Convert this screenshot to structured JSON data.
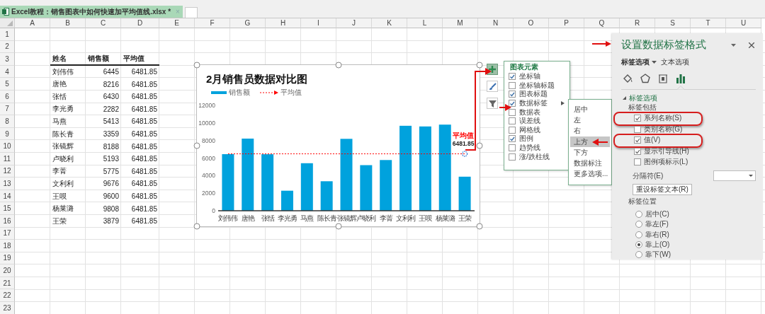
{
  "tab": {
    "title": "Excel教程：销售图表中如何快速加平均值线.xlsx *",
    "close": "×"
  },
  "sheet": {
    "columns": [
      "A",
      "B",
      "C",
      "D",
      "E",
      "F",
      "G",
      "H",
      "I",
      "J",
      "K",
      "L",
      "M",
      "N",
      "O",
      "P",
      "Q",
      "R",
      "S",
      "T",
      "U"
    ],
    "rows": [
      "1",
      "2",
      "3",
      "4",
      "5",
      "6",
      "7",
      "8",
      "9",
      "10",
      "11",
      "12",
      "13",
      "14",
      "15",
      "16",
      "17",
      "18",
      "19",
      "20",
      "21",
      "22",
      "23"
    ],
    "table": {
      "header": [
        "姓名",
        "销售额",
        "平均值"
      ],
      "rows": [
        [
          "刘伟伟",
          "6445",
          "6481.85"
        ],
        [
          "唐艳",
          "8216",
          "6481.85"
        ],
        [
          "张恬",
          "6430",
          "6481.85"
        ],
        [
          "李光勇",
          "2282",
          "6481.85"
        ],
        [
          "马燕",
          "5413",
          "6481.85"
        ],
        [
          "陈长青",
          "3359",
          "6481.85"
        ],
        [
          "张镜辉",
          "8188",
          "6481.85"
        ],
        [
          "卢晓利",
          "5193",
          "6481.85"
        ],
        [
          "李菁",
          "5775",
          "6481.85"
        ],
        [
          "文利利",
          "9676",
          "6481.85"
        ],
        [
          "王呗",
          "9600",
          "6481.85"
        ],
        [
          "杨莱潞",
          "9808",
          "6481.85"
        ],
        [
          "王荣",
          "3879",
          "6481.85"
        ]
      ]
    }
  },
  "chart": {
    "title": "2月销售员数据对比图",
    "point_label": [
      "平均值",
      "6481.85"
    ],
    "chart_data": {
      "type": "bar",
      "categories": [
        "刘伟伟",
        "唐艳",
        "张恬",
        "李光勇",
        "马燕",
        "陈长青",
        "张镜辉",
        "卢晓利",
        "李菁",
        "文利利",
        "王呗",
        "杨莱潞",
        "王荣"
      ],
      "series": [
        {
          "name": "销售额",
          "type": "bar",
          "color": "#00a2dd",
          "values": [
            6445,
            8216,
            6430,
            2282,
            5413,
            3359,
            8188,
            5193,
            5775,
            9676,
            9600,
            9808,
            3879
          ]
        },
        {
          "name": "平均值",
          "type": "line",
          "line_style": "dashed",
          "color": "#ff0000",
          "values": [
            6481.85,
            6481.85,
            6481.85,
            6481.85,
            6481.85,
            6481.85,
            6481.85,
            6481.85,
            6481.85,
            6481.85,
            6481.85,
            6481.85,
            6481.85
          ]
        }
      ],
      "ylim": [
        0,
        12000
      ],
      "yticks": [
        0,
        2000,
        4000,
        6000,
        8000,
        10000,
        12000
      ]
    }
  },
  "chart_buttons": [
    {
      "kind": "elements",
      "selected": true
    },
    {
      "kind": "styles",
      "selected": false
    },
    {
      "kind": "filter",
      "selected": false
    }
  ],
  "chart_elements": {
    "title": "图表元素",
    "items": [
      {
        "label": "坐标轴",
        "checked": true
      },
      {
        "label": "坐标轴标题",
        "checked": false
      },
      {
        "label": "图表标题",
        "checked": true
      },
      {
        "label": "数据标签",
        "checked": true,
        "submenu": true
      },
      {
        "label": "数据表",
        "checked": false
      },
      {
        "label": "误差线",
        "checked": false
      },
      {
        "label": "网格线",
        "checked": false
      },
      {
        "label": "图例",
        "checked": true
      },
      {
        "label": "趋势线",
        "checked": false
      },
      {
        "label": "涨/跌柱线",
        "checked": false
      }
    ],
    "submenu": [
      {
        "label": "居中",
        "selected": false
      },
      {
        "label": "左",
        "selected": false
      },
      {
        "label": "右",
        "selected": false
      },
      {
        "label": "上方",
        "selected": true
      },
      {
        "label": "下方",
        "selected": false
      },
      {
        "label": "数据标注",
        "selected": false
      },
      {
        "label": "更多选项...",
        "selected": false
      }
    ]
  },
  "format_panel": {
    "title": "设置数据标签格式",
    "tabs": [
      {
        "label": "标签选项",
        "selected": true
      },
      {
        "label": "文本选项",
        "selected": false
      }
    ],
    "icon_tabs": [
      {
        "kind": "fill",
        "selected": false
      },
      {
        "kind": "effects",
        "selected": false
      },
      {
        "kind": "size",
        "selected": false
      },
      {
        "kind": "options",
        "selected": true
      }
    ],
    "section": "标签选项",
    "include_label": "标签包括",
    "includes": [
      {
        "label": "系列名称(S)",
        "checked": true,
        "highlighted": true
      },
      {
        "label": "类别名称(G)",
        "checked": false,
        "highlighted": false
      },
      {
        "label": "值(V)",
        "checked": true,
        "highlighted": true
      },
      {
        "label": "显示引导线(H)",
        "checked": true,
        "highlighted": false
      },
      {
        "label": "图例项标示(L)",
        "checked": false,
        "highlighted": false
      }
    ],
    "separator_label": "分隔符(E)",
    "reset_button": "重设标签文本(R)",
    "position_label": "标签位置",
    "positions": [
      {
        "label": "居中(C)",
        "selected": false
      },
      {
        "label": "靠左(F)",
        "selected": false
      },
      {
        "label": "靠右(R)",
        "selected": false
      },
      {
        "label": "靠上(O)",
        "selected": true
      },
      {
        "label": "靠下(W)",
        "selected": false
      }
    ]
  }
}
